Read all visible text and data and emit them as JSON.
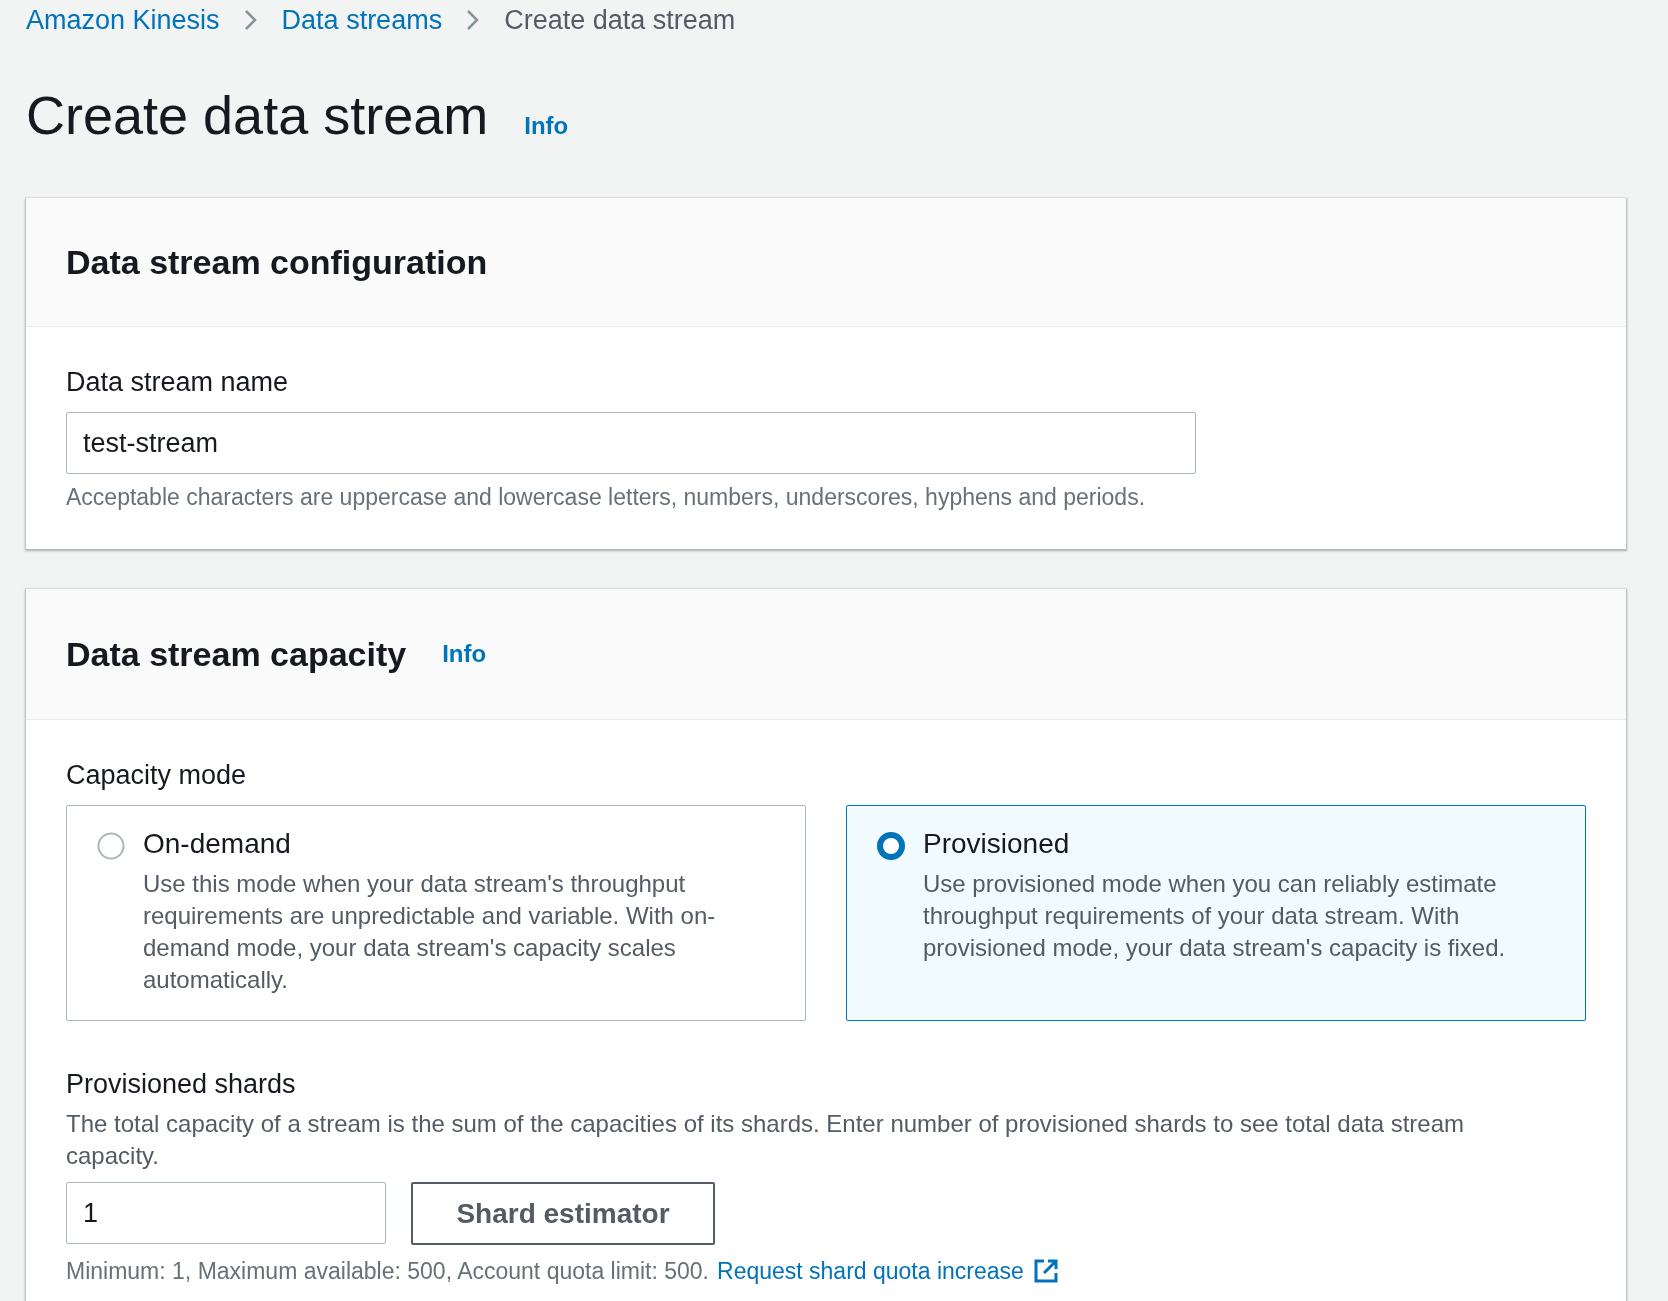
{
  "breadcrumbs": [
    {
      "label": "Amazon Kinesis",
      "current": false
    },
    {
      "label": "Data streams",
      "current": false
    },
    {
      "label": "Create data stream",
      "current": true
    }
  ],
  "title": "Create data stream",
  "title_info": "Info",
  "configuration": {
    "title": "Data stream configuration",
    "name_label": "Data stream name",
    "name_value": "test-stream",
    "name_hint": "Acceptable characters are uppercase and lowercase letters, numbers, underscores, hyphens and periods."
  },
  "capacity": {
    "title": "Data stream capacity",
    "info": "Info",
    "mode_label": "Capacity mode",
    "modes": [
      {
        "title": "On-demand",
        "description": "Use this mode when your data stream's throughput requirements are unpredictable and variable. With on-demand mode, your data stream's capacity scales automatically.",
        "selected": false
      },
      {
        "title": "Provisioned",
        "description": "Use provisioned mode when you can reliably estimate throughput requirements of your data stream. With provisioned mode, your data stream's capacity is fixed.",
        "selected": true
      }
    ],
    "shards_label": "Provisioned shards",
    "shards_description": "The total capacity of a stream is the sum of the capacities of its shards. Enter number of provisioned shards to see total data stream capacity.",
    "shards_value": "1",
    "estimator_button": "Shard estimator",
    "limits": "Minimum: 1, Maximum available: 500, Account quota limit: 500.",
    "quota_link": "Request shard quota increase"
  }
}
